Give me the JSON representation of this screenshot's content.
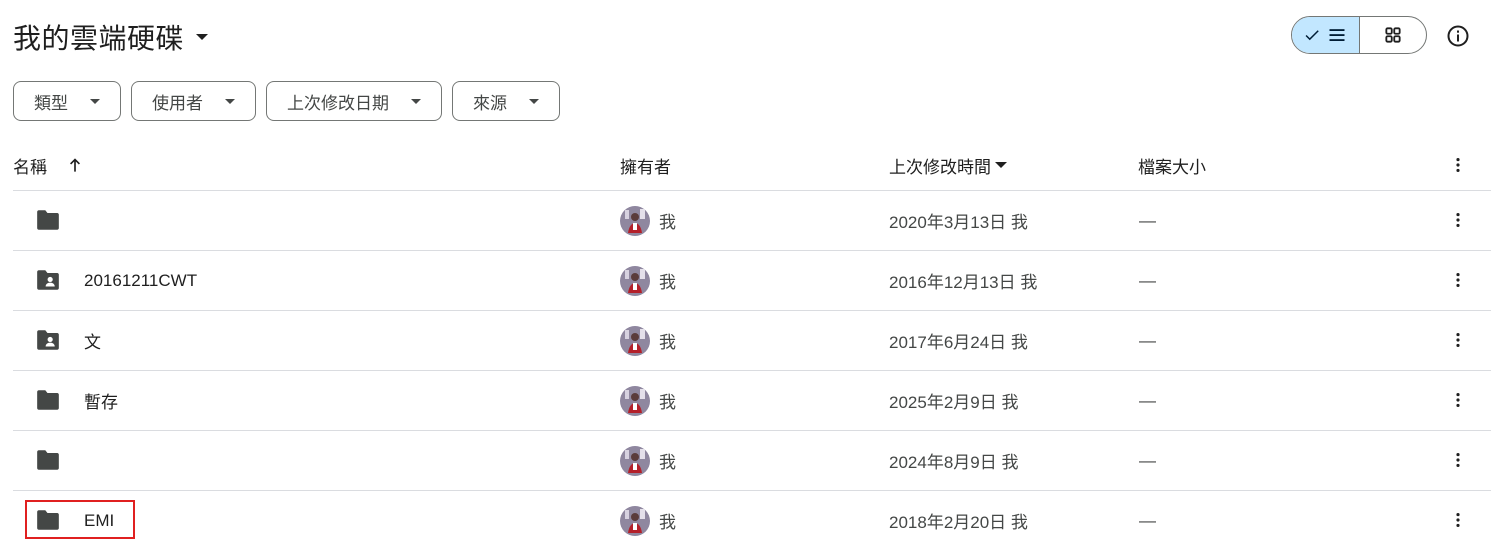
{
  "header": {
    "title": "我的雲端硬碟",
    "title_icon": "caret-down-icon",
    "view_list_icons": [
      "check-icon",
      "list-icon"
    ],
    "view_grid_icon": "grid-icon",
    "info_icon": "info-icon",
    "selected_view": "list"
  },
  "filters": [
    {
      "label": "類型"
    },
    {
      "label": "使用者"
    },
    {
      "label": "上次修改日期"
    },
    {
      "label": "來源"
    }
  ],
  "table": {
    "columns": {
      "name": "名稱",
      "owner": "擁有者",
      "modified": "上次修改時間",
      "size": "檔案大小"
    },
    "sort_icon": "arrow-up-icon",
    "rows": [
      {
        "name": "",
        "icon": "folder-icon",
        "owner": "我",
        "modified": "2020年3月13日 我",
        "size": "—"
      },
      {
        "name": "20161211CWT",
        "icon": "shared-folder-icon",
        "owner": "我",
        "modified": "2016年12月13日 我",
        "size": "—"
      },
      {
        "name": "文",
        "icon": "shared-folder-icon",
        "owner": "我",
        "modified": "2017年6月24日 我",
        "size": "—"
      },
      {
        "name": "暫存",
        "icon": "folder-icon",
        "owner": "我",
        "modified": "2025年2月9日 我",
        "size": "—"
      },
      {
        "name": "",
        "icon": "folder-icon",
        "owner": "我",
        "modified": "2024年8月9日 我",
        "size": "—"
      },
      {
        "name": "EMI",
        "icon": "folder-icon",
        "owner": "我",
        "modified": "2018年2月20日 我",
        "size": "—",
        "highlighted": true
      }
    ]
  },
  "colors": {
    "accent_selected": "#c2e7ff",
    "highlight_box": "#e02020",
    "divider": "#dadce0"
  }
}
